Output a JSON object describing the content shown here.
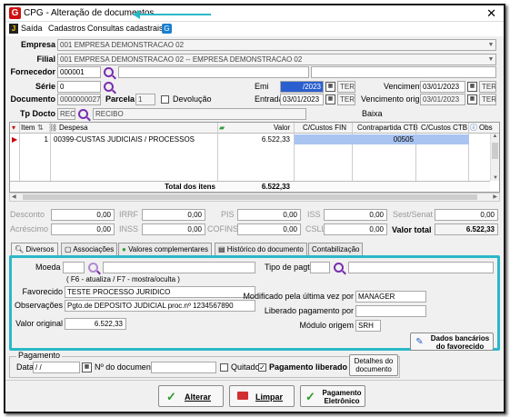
{
  "window": {
    "title": "CPG - Alteração de documentos",
    "close_glyph": "✕"
  },
  "menu": {
    "saida": "Saída",
    "cadastros": "Cadastros",
    "consultas": "Consultas cadastrais"
  },
  "header": {
    "empresa_label": "Empresa",
    "empresa_value": "001 EMPRESA DEMONSTRACAO 02",
    "filial_label": "Filial",
    "filial_value": "001 EMPRESA DEMONSTRACAO 02 -- EMPRESA DEMONSTRACAO 02",
    "fornecedor_label": "Fornecedor",
    "fornecedor_value": "000001",
    "serie_label": "Série",
    "serie_value": "0",
    "documento_label": "Documento",
    "documento_value": "0000000027",
    "parcela_label": "Parcela",
    "parcela_value": "1",
    "devolucao_label": "Devolução",
    "tpdocto_label": "Tp Docto",
    "tpdocto_code": "REC",
    "tpdocto_desc": "RECIBO",
    "emi_label": "Emi",
    "emi_value": "/2023",
    "emi_day": "TER",
    "entrada_label": "Entrada",
    "entrada_value": "03/01/2023",
    "entrada_day": "TER",
    "vencimento_label": "Vencimento",
    "vencimento_value": "03/01/2023",
    "vencimento_day": "TER",
    "vencorig_label": "Vencimento original",
    "vencorig_value": "03/01/2023",
    "vencorig_day": "TER",
    "baixa_label": "Baixa"
  },
  "grid": {
    "columns": [
      "Item",
      "Despesa",
      "Valor",
      "C/Custos FIN",
      "Contrapartida CTB",
      "C/Custos CTB",
      "Obs"
    ],
    "rows": [
      {
        "item": "1",
        "despesa": "00399-CUSTAS JUDICIAIS / PROCESSOS",
        "valor": "6.522,33",
        "contrapartida": "00505"
      }
    ],
    "total_label": "Total dos itens",
    "total_value": "6.522,33"
  },
  "totals": {
    "desconto_label": "Desconto",
    "desconto_value": "0,00",
    "irrf_label": "IRRF",
    "irrf_value": "0,00",
    "pis_label": "PIS",
    "pis_value": "0,00",
    "iss_label": "ISS",
    "iss_value": "0,00",
    "sestsenat_label": "Sest/Senat",
    "sestsenat_value": "0,00",
    "acrescimo_label": "Acréscimo",
    "acrescimo_value": "0,00",
    "inss_label": "INSS",
    "inss_value": "0,00",
    "cofins_label": "COFINS",
    "cofins_value": "0,00",
    "csll_label": "CSLL",
    "csll_value": "0,00",
    "valortotal_label": "Valor total",
    "valortotal_value": "6.522,33"
  },
  "tabs": [
    "Diversos",
    "Associações",
    "Valores complementares",
    "Histórico do documento",
    "Contabilização"
  ],
  "diversos": {
    "moeda_label": "Moeda",
    "hint": "( F6 - atualiza / F7 - mostra/oculta )",
    "tipopagto_label": "Tipo de pagto",
    "favorecido_label": "Favorecido",
    "favorecido_value": "TESTE PROCESSO JURIDICO",
    "observacoes_label": "Observações",
    "observacoes_value": "Pgto.de DEPOSITO JUDICIAL proc.nº 1234567890",
    "valororiginal_label": "Valor original",
    "valororiginal_value": "6.522,33",
    "modificado_label": "Modificado pela última vez por",
    "modificado_value": "MANAGER",
    "liberado_label": "Liberado pagamento por",
    "liberado_value": "",
    "modulo_label": "Módulo origem",
    "modulo_value": "SRH",
    "dados_bancarios_line1": "Dados bancários",
    "dados_bancarios_line2": "do favorecido"
  },
  "pagamento": {
    "group_label": "Pagamento",
    "data_label": "Data",
    "data_value": " / /",
    "ndoc_label": "Nº do documento",
    "ndoc_value": "",
    "quitado_label": "Quitado",
    "liberado_label": "Pagamento liberado",
    "liberado_checked": "✓",
    "detalhes_line1": "Detalhes do",
    "detalhes_line2": "documento"
  },
  "actions": {
    "alterar": "Alterar",
    "limpar": "Limpar",
    "pagamento_line1": "Pagamento",
    "pagamento_line2": "Eletrônico"
  },
  "colors": {
    "accent": "#2ab8c8",
    "selection": "#a9c4f0",
    "brand": "#d01010"
  }
}
